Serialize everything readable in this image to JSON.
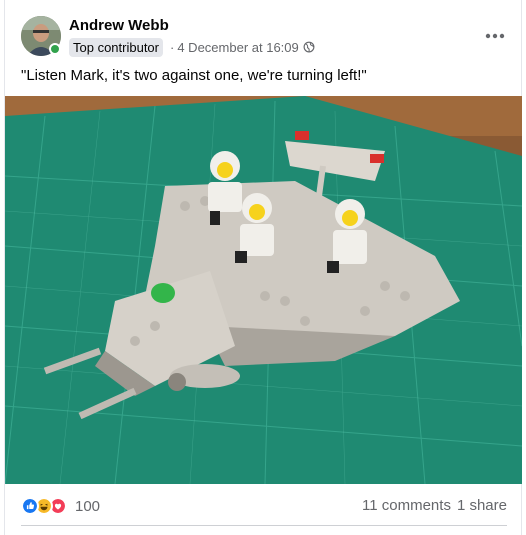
{
  "post": {
    "author": "Andrew Webb",
    "badge": "Top contributor",
    "separator": "·",
    "timestamp": "4 December at 16:09",
    "text": "\"Listen Mark, it's two against one, we're turning left!\"",
    "audience_icon": "globe-icon",
    "more_icon": "more-options-icon",
    "image_subject": "lego-spaceship-photo"
  },
  "footer": {
    "reactions": [
      "like-icon",
      "haha-icon",
      "love-icon"
    ],
    "reaction_count": "100",
    "comments": "11 comments",
    "shares": "1 share"
  },
  "colors": {
    "like": "#1877f2",
    "haha": "#f7b928",
    "love": "#f33e58",
    "online": "#31a24c",
    "secondary_text": "#65676b",
    "mat": "#1f8a72"
  }
}
